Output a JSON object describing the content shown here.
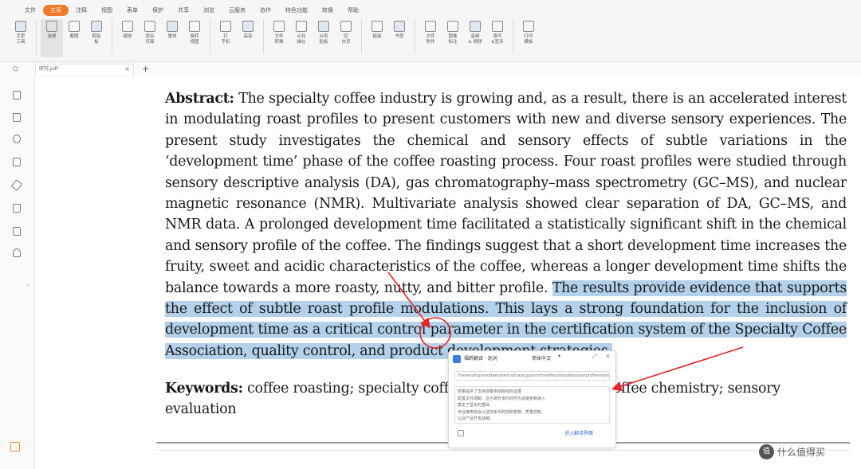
{
  "ribbon": {
    "tabs": [
      "文件",
      "主页",
      "注释",
      "视图",
      "表单",
      "保护",
      "共享",
      "浏览",
      "云服务",
      "协作",
      "特色功能",
      "转换",
      "帮助"
    ],
    "active_tab": 1,
    "tools": [
      {
        "label": "手型\n工具",
        "icon": "hand-icon"
      },
      {
        "label": "选择",
        "icon": "text-select-icon"
      },
      {
        "label": "截图",
        "icon": "screenshot-icon"
      },
      {
        "label": "剪贴\n板",
        "icon": "clipboard-icon"
      },
      {
        "label": "缩放",
        "icon": "zoom-icon"
      },
      {
        "label": "适合\n页面",
        "icon": "fit-page-icon"
      },
      {
        "label": "重排",
        "icon": "reflow-icon"
      },
      {
        "label": "旋转\n视图",
        "icon": "rotate-view-icon"
      },
      {
        "label": "打\n字机",
        "icon": "typewriter-icon"
      },
      {
        "label": "高亮",
        "icon": "highlight-icon"
      },
      {
        "label": "文件\n转换",
        "icon": "file-convert-icon"
      },
      {
        "label": "从扫\n描仪",
        "icon": "scanner-icon"
      },
      {
        "label": "从剪\n贴板",
        "icon": "from-clipboard-icon"
      },
      {
        "label": "空\n白页",
        "icon": "blank-page-icon"
      },
      {
        "label": "链接",
        "icon": "link-icon"
      },
      {
        "label": "书签",
        "icon": "bookmark-icon"
      },
      {
        "label": "文件\n附件",
        "icon": "attachment-icon"
      },
      {
        "label": "图像\n标注",
        "icon": "image-annotation-icon"
      },
      {
        "label": "音频\n& 视频",
        "icon": "media-icon"
      },
      {
        "label": "填写\n&签名",
        "icon": "fill-sign-icon"
      },
      {
        "label": "打印\n模板",
        "icon": "print-template-icon"
      }
    ]
  },
  "document": {
    "tab_name": "研究.pdf",
    "abstract_label": "Abstract:",
    "abstract_text": "The specialty coffee industry is growing and, as a result, there is an accelerated interest in modulating roast profiles to present customers with new and diverse sensory experiences. The present study investigates the chemical and sensory effects of subtle variations in the ‘development time’ phase of the coffee roasting process. Four roast profiles were studied through sensory descriptive analysis (DA), gas chromatography–mass spectrometry (GC–MS), and nuclear magnetic resonance (NMR). Multivariate analysis showed clear separation of DA, GC–MS, and NMR data. A prolonged development time facilitated a statistically significant shift in the chemical and sensory profile of the coffee. The findings suggest that a short development time increases the fruity, sweet and acidic characteristics of the coffee, whereas a longer development time shifts the balance towards a more roasty, nutty, and bitter profile. ",
    "abstract_highlighted": "The results provide evidence that supports the effect of subtle roast profile modulations. This lays a strong foundation for the inclusion of development time as a critical control parameter in the certification system of the Specialty Coffee Association, quality control, and product development strategies.",
    "keywords_label": "Keywords:",
    "keywords_text": "coffee roasting; specialty coffee; development time; coffee chemistry; sensory evaluation"
  },
  "translate_popup": {
    "title": "福昕翻译 · 划词",
    "target_language": "简体中文",
    "source_text": "Theresultsprovideevidencethatsupportstheeffectofsubtleroastprofilemodulations",
    "result_lines": [
      "结果提供了支持调整烘焙曲线的证据",
      "配置文件调制。这为将开发时间作为关键参数纳入",
      "奠定了坚实的基础",
      "专业咖啡协会认证体系中的控制参数、质量控制、",
      "以及产品开发战略。"
    ],
    "open_link": "进入翻译界面"
  },
  "watermark": {
    "logo": "值",
    "text": "什么值得买"
  },
  "colors": {
    "accent": "#f07a2a",
    "highlight": "#b3d1ea",
    "arrow": "#e8232a",
    "link": "#2f6ed8"
  }
}
